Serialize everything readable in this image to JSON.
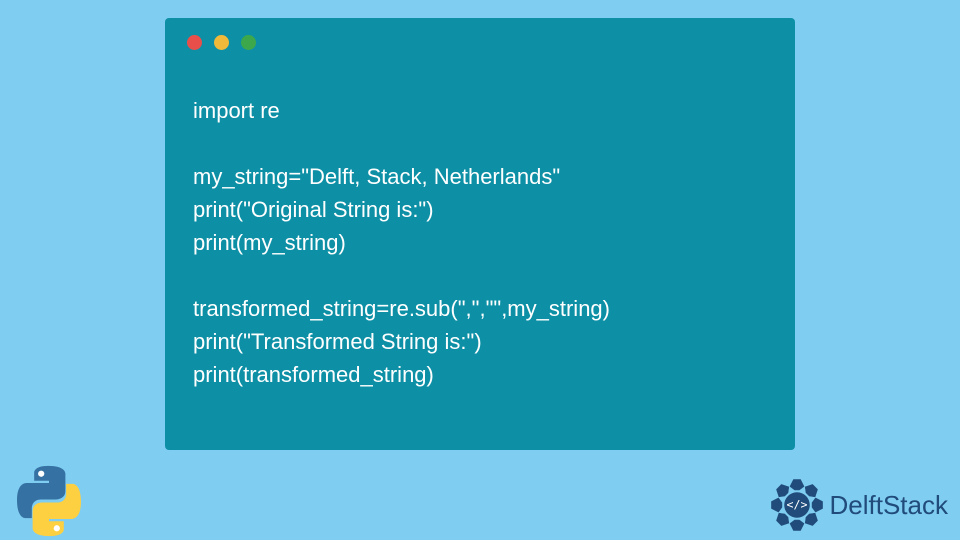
{
  "code": {
    "lines": [
      "import re",
      "",
      "my_string=\"Delft, Stack, Netherlands\"",
      "print(\"Original String is:\")",
      "print(my_string)",
      "",
      "transformed_string=re.sub(\",\",\"\",my_string)",
      "print(\"Transformed String is:\")",
      "print(transformed_string)"
    ]
  },
  "brand": {
    "name": "DelftStack"
  },
  "colors": {
    "bg": "#7fcdf1",
    "window": "#0d90a6",
    "text": "#ffffff",
    "brand": "#204b7a"
  }
}
